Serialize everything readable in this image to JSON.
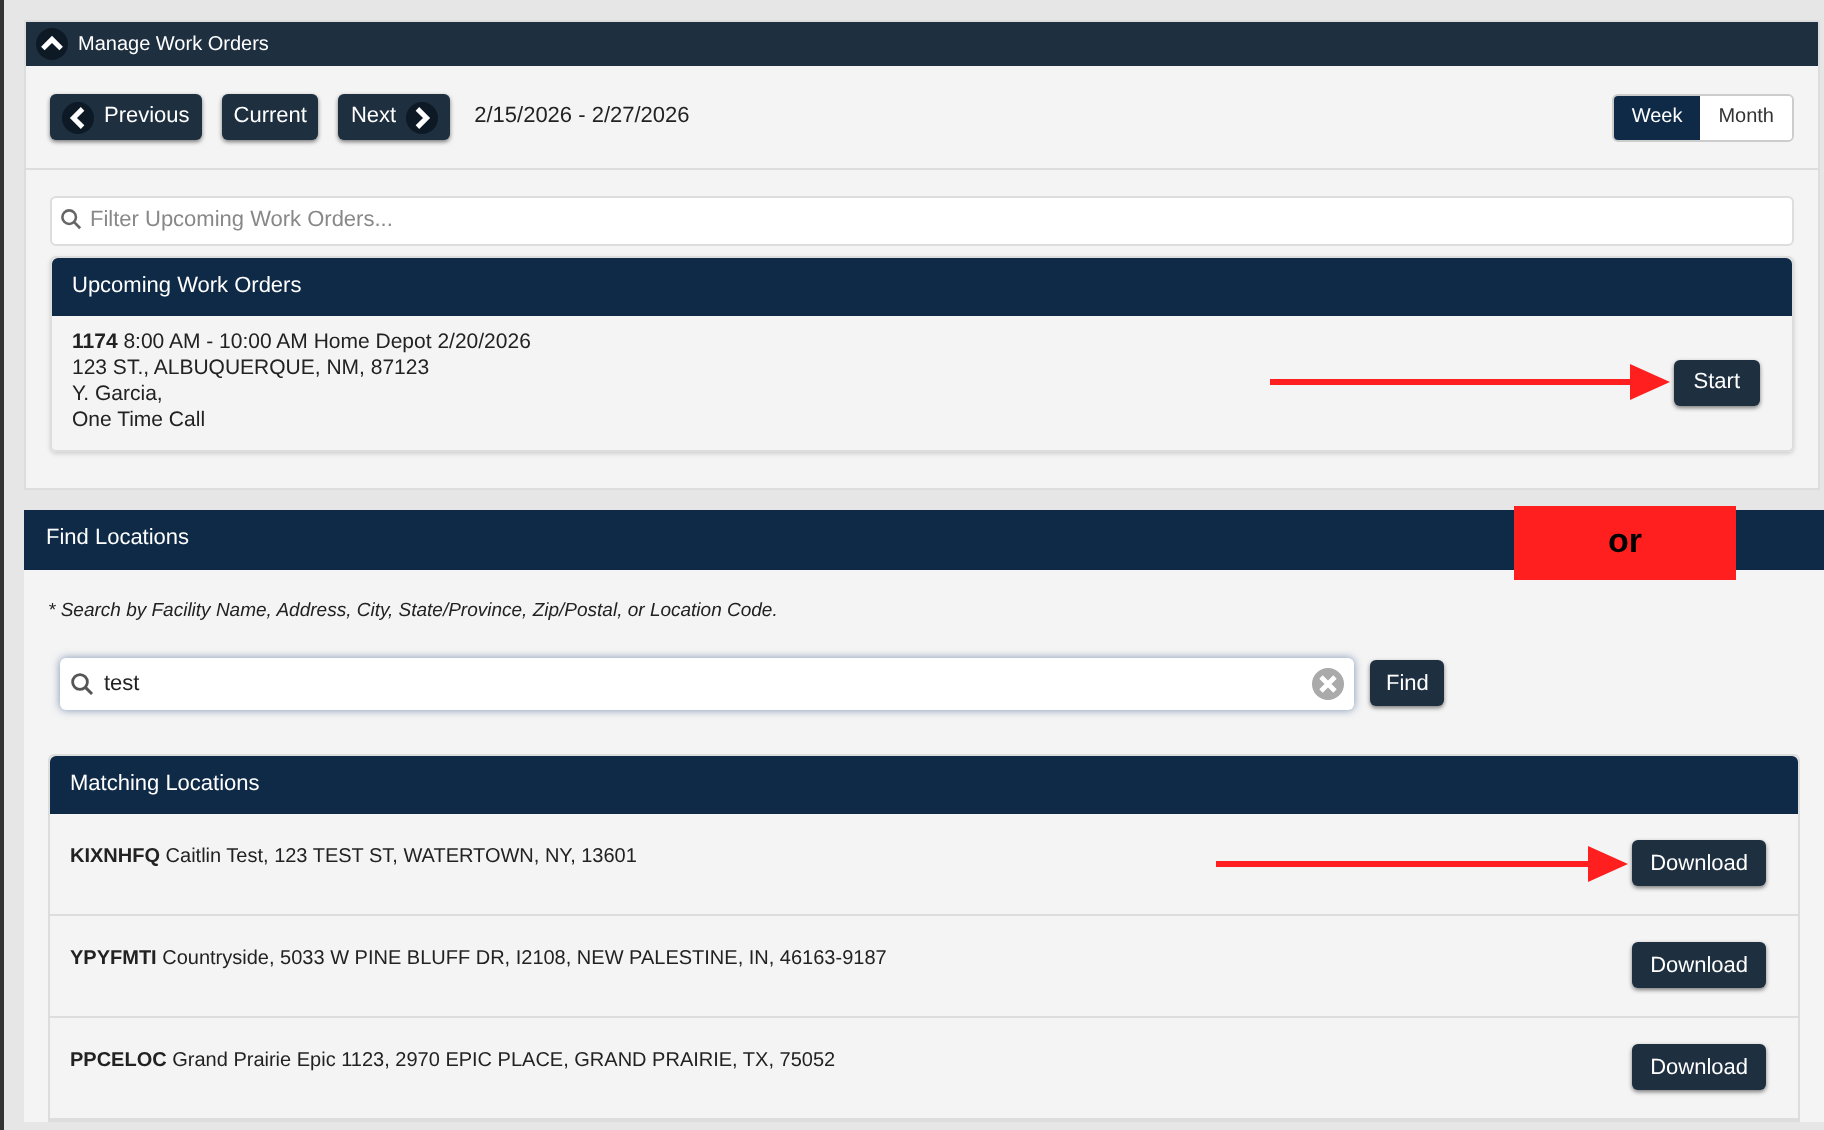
{
  "manage_panel": {
    "title": "Manage Work Orders",
    "expanded": true,
    "nav_buttons": [
      {
        "label": "Previous",
        "kind": "prev"
      },
      {
        "label": "Current",
        "kind": "plain"
      },
      {
        "label": "Next",
        "kind": "next"
      }
    ],
    "date_range": "2/15/2026 - 2/27/2026",
    "view_toggle": [
      {
        "label": "Week",
        "selected": true
      },
      {
        "label": "Month",
        "selected": false
      }
    ],
    "filter": {
      "placeholder": "Filter Upcoming Work Orders..."
    },
    "upcoming": {
      "title": "Upcoming Work Orders",
      "orders": [
        {
          "id": "1174",
          "summary": "8:00 AM - 10:00 AM Home Depot 2/20/2026",
          "address": "123 ST., ALBUQUERQUE, NM, 87123",
          "contact": "Y. Garcia,",
          "call_type": "One Time Call",
          "button": "Start",
          "arrow": true
        }
      ]
    }
  },
  "find_panel": {
    "title": "Find Locations",
    "annotation": "or",
    "hint": "* Search by Facility Name, Address, City, State/Province, Zip/Postal, or Location Code.",
    "search": {
      "value": "test"
    },
    "find_button": "Find",
    "matching": {
      "title": "Matching Locations",
      "rows": [
        {
          "code": "KIXNHFQ",
          "details": "Caitlin Test, 123 TEST ST, WATERTOWN, NY, 13601",
          "button": "Download",
          "arrow": true
        },
        {
          "code": "YPYFMTI",
          "details": "Countryside, 5033 W PINE BLUFF DR, I2108, NEW PALESTINE, IN, 46163-9187",
          "button": "Download",
          "arrow": false
        },
        {
          "code": "PPCELOC",
          "details": "Grand Prairie Epic 1123, 2970 EPIC PLACE, GRAND PRAIRIE, TX, 75052",
          "button": "Download",
          "arrow": false
        }
      ]
    }
  }
}
